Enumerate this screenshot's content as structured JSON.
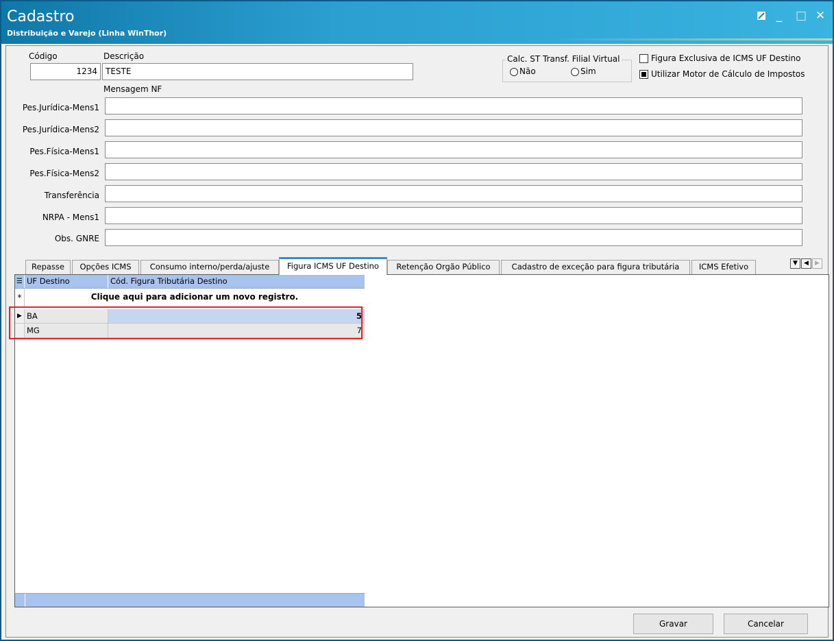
{
  "window": {
    "title": "Cadastro",
    "subtitle": "Distribuição e Varejo (Linha WinThor)",
    "controls": {
      "restore_icon": "restore-icon",
      "minimize": "_",
      "maximize": "□",
      "close": "✕"
    }
  },
  "form": {
    "codigo_label": "Código",
    "codigo_value": "1234",
    "descricao_label": "Descrição",
    "descricao_value": "TESTE",
    "mensagem_nf_label": "Mensagem NF",
    "calc_st": {
      "label": "Calc. ST Transf. Filial Virtual",
      "option_nao": "Não",
      "option_sim": "Sim"
    },
    "figura_exclusiva": {
      "label": "Figura Exclusiva de ICMS UF Destino",
      "checked": false
    },
    "utilizar_motor": {
      "label": "Utilizar Motor de Cálculo de Impostos",
      "checked": true
    },
    "fields": [
      {
        "label": "Pes.Jurídica-Mens1",
        "value": ""
      },
      {
        "label": "Pes.Jurídica-Mens2",
        "value": ""
      },
      {
        "label": "Pes.Física-Mens1",
        "value": ""
      },
      {
        "label": "Pes.Física-Mens2",
        "value": ""
      },
      {
        "label": "Transferência",
        "value": ""
      },
      {
        "label": "NRPA - Mens1",
        "value": ""
      },
      {
        "label": "Obs. GNRE",
        "value": ""
      }
    ]
  },
  "tabs": [
    {
      "label": "Repasse"
    },
    {
      "label": "Opções ICMS"
    },
    {
      "label": "Consumo interno/perda/ajuste"
    },
    {
      "label": "Figura ICMS UF Destino",
      "active": true
    },
    {
      "label": "Retenção Orgão Público"
    },
    {
      "label": "Cadastro de exceção para figura tributária"
    },
    {
      "label": "ICMS Efetivo"
    }
  ],
  "grid": {
    "columns": [
      "UF Destino",
      "Cód. Figura Tributária Destino"
    ],
    "new_row_text": "Clique aqui para adicionar um novo registro.",
    "rows": [
      {
        "uf": "BA",
        "cod": "5"
      },
      {
        "uf": "MG",
        "cod": "7"
      }
    ]
  },
  "buttons": {
    "gravar": "Gravar",
    "cancelar": "Cancelar"
  }
}
